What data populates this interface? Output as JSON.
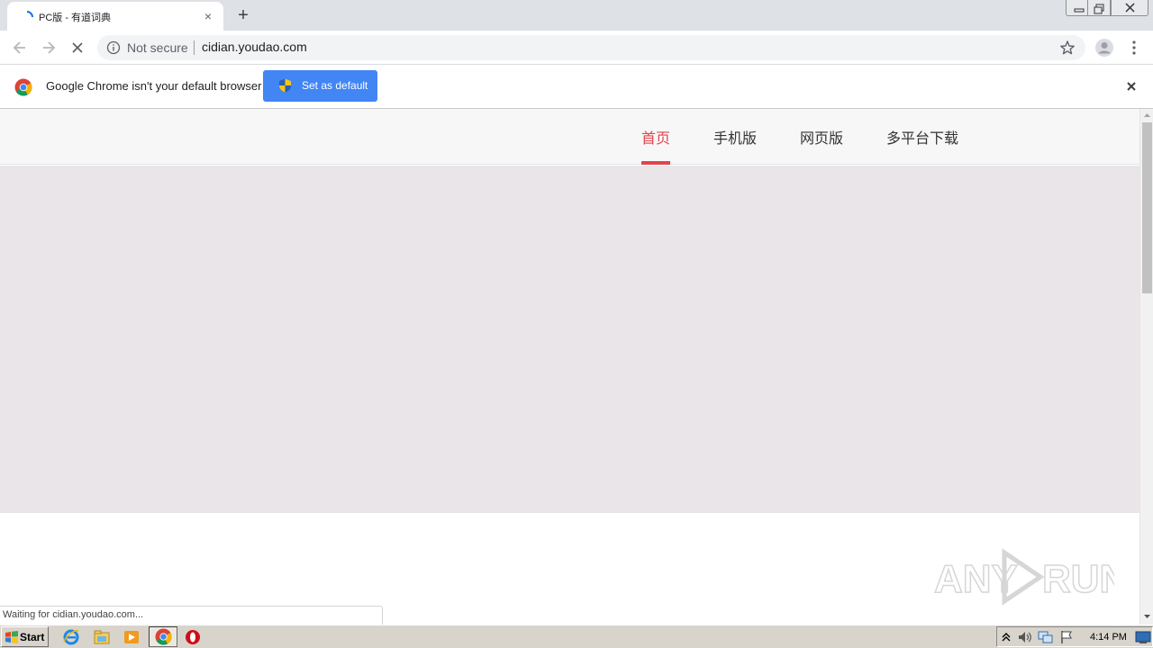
{
  "browser": {
    "tab": {
      "title": "PC版 - 有道词典",
      "close_label": "×"
    },
    "new_tab_label": "+",
    "omnibox": {
      "security_label": "Not secure",
      "url": "cidian.youdao.com"
    }
  },
  "infobar": {
    "message": "Google Chrome isn't your default browser",
    "set_default_label": "Set as default"
  },
  "site": {
    "nav": [
      {
        "label": "首页",
        "active": true
      },
      {
        "label": "手机版",
        "active": false
      },
      {
        "label": "网页版",
        "active": false
      },
      {
        "label": "多平台下载",
        "active": false
      }
    ],
    "accent_color": "#e0454d",
    "hero_color": "#e9e5e8"
  },
  "status_bar": {
    "text": "Waiting for cidian.youdao.com..."
  },
  "watermark": {
    "text": "ANY RUN"
  },
  "taskbar": {
    "start_label": "Start",
    "clock": "4:14 PM",
    "pinned": [
      "ie-icon",
      "explorer-icon",
      "media-player-icon",
      "chrome-icon",
      "opera-icon"
    ]
  }
}
